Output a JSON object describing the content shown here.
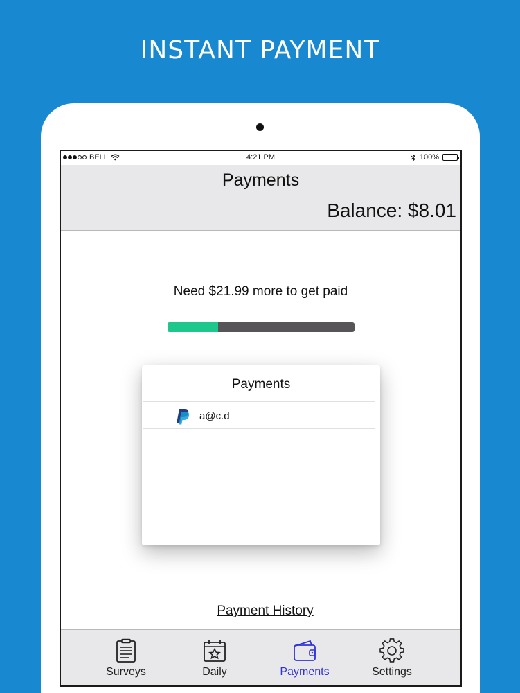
{
  "banner": {
    "title": "INSTANT PAYMENT"
  },
  "status_bar": {
    "carrier": "BELL",
    "time": "4:21 PM",
    "battery": "100%"
  },
  "nav": {
    "title": "Payments",
    "balance": "Balance: $8.01"
  },
  "progress": {
    "message": "Need $21.99 more to get paid",
    "fraction": 0.27,
    "fill_color": "#1ec88d",
    "track_color": "#575558"
  },
  "payments_card": {
    "title": "Payments",
    "methods": [
      {
        "icon": "paypal-icon",
        "email": "a@c.d"
      }
    ]
  },
  "payment_history_link": "Payment History",
  "tabs": [
    {
      "id": "surveys",
      "label": "Surveys",
      "icon": "clipboard-icon",
      "active": false
    },
    {
      "id": "daily",
      "label": "Daily",
      "icon": "calendar-star-icon",
      "active": false
    },
    {
      "id": "payments",
      "label": "Payments",
      "icon": "wallet-icon",
      "active": true
    },
    {
      "id": "settings",
      "label": "Settings",
      "icon": "gear-icon",
      "active": false
    }
  ],
  "colors": {
    "background": "#1888d0",
    "active_tab": "#2f33d8"
  }
}
